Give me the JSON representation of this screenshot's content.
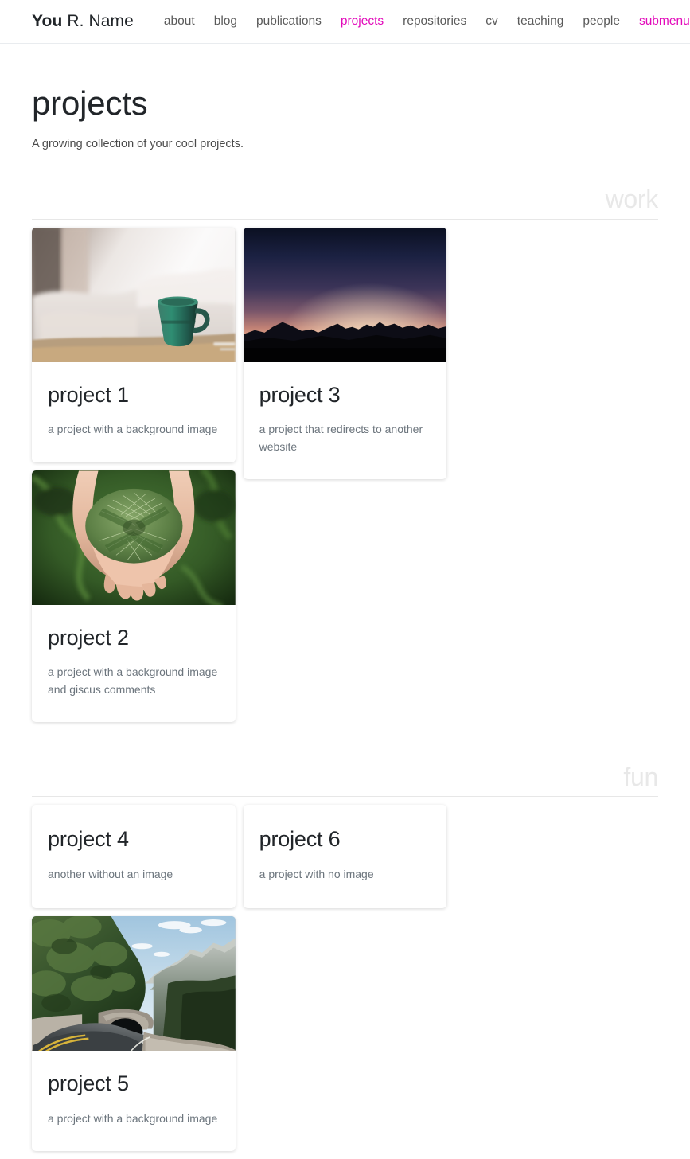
{
  "header": {
    "brand_strong": "You",
    "brand_rest": " R. Name",
    "nav_items": [
      {
        "label": "about",
        "state": "default"
      },
      {
        "label": "blog",
        "state": "default"
      },
      {
        "label": "publications",
        "state": "default"
      },
      {
        "label": "projects",
        "state": "active"
      },
      {
        "label": "repositories",
        "state": "default"
      },
      {
        "label": "cv",
        "state": "default"
      },
      {
        "label": "teaching",
        "state": "default"
      },
      {
        "label": "people",
        "state": "default"
      },
      {
        "label": "submenus",
        "state": "accent-dropdown"
      }
    ],
    "theme_toggle_icon": "moon-icon",
    "accent_color": "#e209ba",
    "link_color": "#5a5a5a",
    "border_color": "#e9ecef"
  },
  "main": {
    "title": "projects",
    "description": "A growing collection of your cool projects."
  },
  "categories": [
    {
      "name": "work",
      "projects": [
        {
          "title": "project 1",
          "description": "a project with a background image",
          "has_image": true,
          "image_alt": "blurred bedroom with green coffee mug on nightstand"
        },
        {
          "title": "project 2",
          "description": "a project with a background image and giscus comments",
          "has_image": true,
          "image_alt": "cupped hands holding green pine needles over grass"
        },
        {
          "title": "project 3",
          "description": "a project that redirects to another website",
          "has_image": true,
          "image_alt": "mountain range silhouette at dusk with pink and purple sky"
        }
      ]
    },
    {
      "name": "fun",
      "projects": [
        {
          "title": "project 4",
          "description": "another without an image",
          "has_image": false,
          "image_alt": ""
        },
        {
          "title": "project 5",
          "description": "a project with a background image",
          "has_image": true,
          "image_alt": "winding mountain road leading into a stone tunnel"
        },
        {
          "title": "project 6",
          "description": "a project with no image",
          "has_image": false,
          "image_alt": ""
        }
      ]
    }
  ],
  "colors": {
    "accent": "#e209ba",
    "text": "#212529",
    "muted": "#6c757d",
    "category_title": "#e8e8e8",
    "rule": "#e7e7e7",
    "card_bg": "#ffffff",
    "page_bg": "#ffffff"
  }
}
